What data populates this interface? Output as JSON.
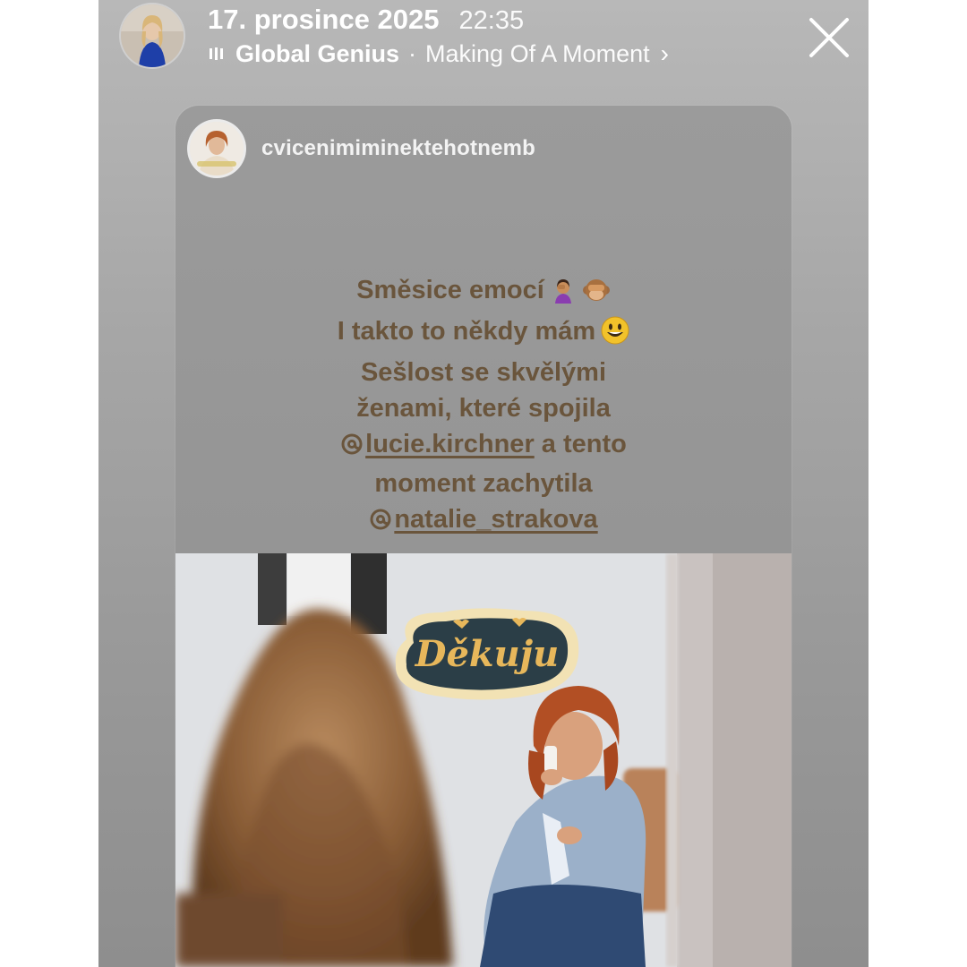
{
  "header": {
    "date": "17. prosince 2025",
    "time": "22:35",
    "music_icon": "music-bars-icon",
    "artist": "Global Genius",
    "separator": "·",
    "song": "Making Of A Moment",
    "chevron": "›",
    "close_icon": "close-icon"
  },
  "shared_post": {
    "username": "cvicenimiminektehotnemb",
    "caption_lines": [
      "Směsice emocí",
      "I takto to někdy mám",
      "Sešlost se skvělými",
      "ženami, které spojila",
      "a tento",
      "moment zachytila"
    ],
    "mentions": [
      "lucie.kirchner",
      "natalie_strakova"
    ],
    "emojis": [
      "woman-facepalming",
      "see-no-evil-monkey",
      "grinning-face"
    ]
  },
  "sticker": {
    "text": "Děkuju"
  },
  "colors": {
    "caption_text": "#6a553c",
    "sticker_bg": "#2b3e47",
    "sticker_outline": "#f2e2b4",
    "sticker_text": "#e7b75b"
  }
}
